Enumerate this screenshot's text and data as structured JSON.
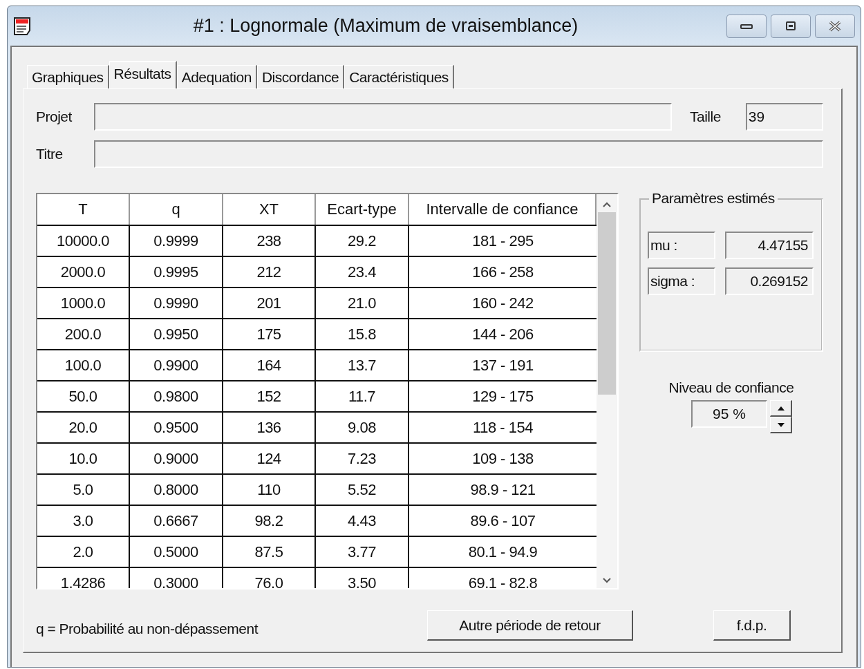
{
  "window": {
    "title": "#1 : Lognormale (Maximum de vraisemblance)"
  },
  "tabs": [
    {
      "label": "Graphiques",
      "selected": false
    },
    {
      "label": "Résultats",
      "selected": true
    },
    {
      "label": "Adequation",
      "selected": false
    },
    {
      "label": "Discordance",
      "selected": false
    },
    {
      "label": "Caractéristiques",
      "selected": false
    }
  ],
  "projet": {
    "label": "Projet"
  },
  "taille": {
    "label": "Taille",
    "value": "39"
  },
  "titre": {
    "label": "Titre"
  },
  "table": {
    "columns": [
      "T",
      "q",
      "XT",
      "Ecart-type",
      "Intervalle de confiance"
    ],
    "rows": [
      [
        "10000.0",
        "0.9999",
        "238",
        "29.2",
        "181 - 295"
      ],
      [
        "2000.0",
        "0.9995",
        "212",
        "23.4",
        "166 - 258"
      ],
      [
        "1000.0",
        "0.9990",
        "201",
        "21.0",
        "160 - 242"
      ],
      [
        "200.0",
        "0.9950",
        "175",
        "15.8",
        "144 - 206"
      ],
      [
        "100.0",
        "0.9900",
        "164",
        "13.7",
        "137 - 191"
      ],
      [
        "50.0",
        "0.9800",
        "152",
        "11.7",
        "129 - 175"
      ],
      [
        "20.0",
        "0.9500",
        "136",
        "9.08",
        "118 - 154"
      ],
      [
        "10.0",
        "0.9000",
        "124",
        "7.23",
        "109 - 138"
      ],
      [
        "5.0",
        "0.8000",
        "110",
        "5.52",
        "98.9 - 121"
      ],
      [
        "3.0",
        "0.6667",
        "98.2",
        "4.43",
        "89.6 - 107"
      ],
      [
        "2.0",
        "0.5000",
        "87.5",
        "3.77",
        "80.1 - 94.9"
      ],
      [
        "1.4286",
        "0.3000",
        "76.0",
        "3.50",
        "69.1 - 82.8"
      ]
    ]
  },
  "parametres": {
    "title": "Paramètres estimés",
    "items": [
      {
        "name": "mu :",
        "value": "4.47155"
      },
      {
        "name": "sigma :",
        "value": "0.269152"
      }
    ]
  },
  "niveau": {
    "label": "Niveau de confiance",
    "value": "95 %"
  },
  "note": "q = Probabilité au non-dépassement",
  "buttons": [
    "Autre période de retour",
    "f.d.p."
  ]
}
